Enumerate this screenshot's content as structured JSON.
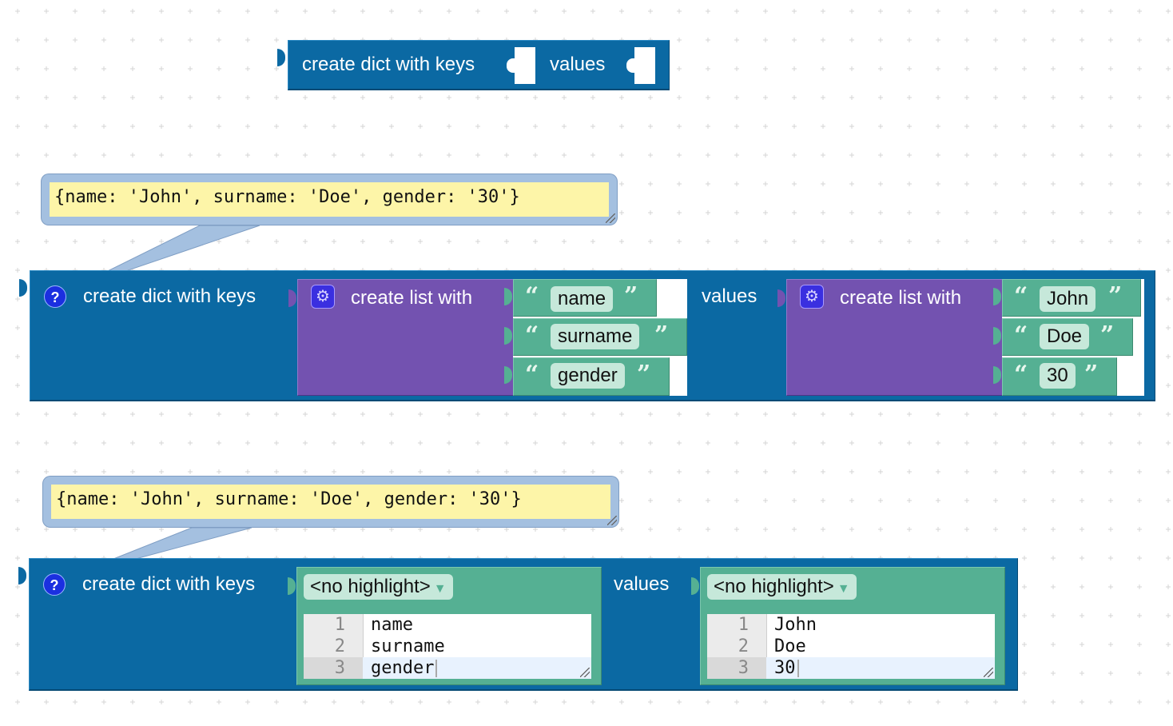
{
  "workspace": {
    "grid_color": "#d4d4d4",
    "colors": {
      "dict_block": "#0b69a3",
      "list_block": "#7352b0",
      "text_block": "#55b093",
      "bubble_frame": "#a4c0e0",
      "bubble_fill": "#fdf5a8"
    }
  },
  "block1": {
    "label": "create dict with keys",
    "values_label": "values"
  },
  "block2": {
    "help_icon": "?",
    "label": "create dict with keys",
    "values_label": "values",
    "comment": "{name: 'John', surname: 'Doe', gender: '30'}",
    "keys_list": {
      "gear_icon": "⚙",
      "label": "create list with",
      "items": [
        "name",
        "surname",
        "gender"
      ]
    },
    "values_list": {
      "gear_icon": "⚙",
      "label": "create list with",
      "items": [
        "John",
        "Doe",
        "30"
      ]
    },
    "quote_open": "“",
    "quote_close": "”"
  },
  "block3": {
    "help_icon": "?",
    "label": "create dict with keys",
    "values_label": "values",
    "comment": "{name: 'John', surname: 'Doe', gender: '30'}",
    "keys_editor": {
      "dropdown": "<no highlight>",
      "dropdown_arrow": "▼",
      "lines": [
        {
          "num": "1",
          "text": "name"
        },
        {
          "num": "2",
          "text": "surname"
        },
        {
          "num": "3",
          "text": "gender"
        }
      ]
    },
    "values_editor": {
      "dropdown": "<no highlight>",
      "dropdown_arrow": "▼",
      "lines": [
        {
          "num": "1",
          "text": "John"
        },
        {
          "num": "2",
          "text": "Doe"
        },
        {
          "num": "3",
          "text": "30"
        }
      ]
    }
  }
}
